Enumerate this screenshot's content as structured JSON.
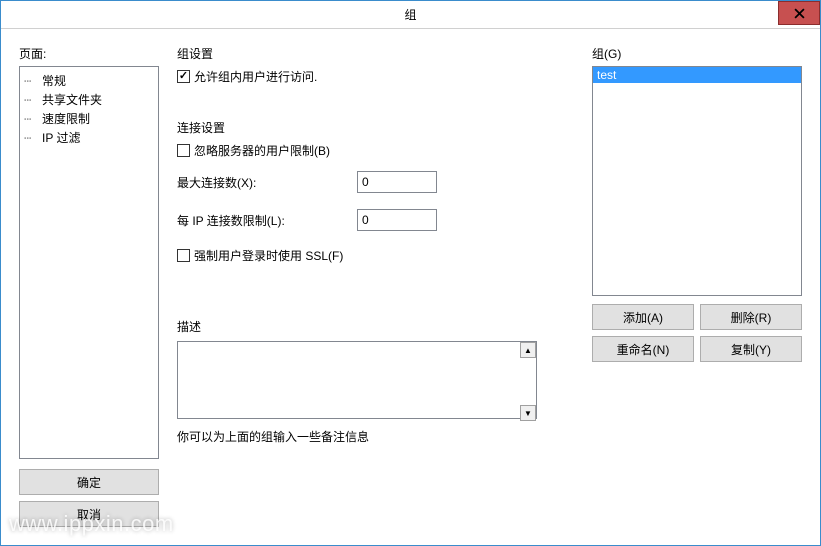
{
  "window": {
    "title": "组"
  },
  "left": {
    "label": "页面:",
    "tree": [
      {
        "label": "常规"
      },
      {
        "label": "共享文件夹"
      },
      {
        "label": "速度限制"
      },
      {
        "label": "IP 过滤"
      }
    ],
    "ok": "确定",
    "cancel": "取消"
  },
  "group_settings": {
    "title": "组设置",
    "allow_access": {
      "label": "允许组内用户进行访问.",
      "checked": true
    }
  },
  "conn_settings": {
    "title": "连接设置",
    "bypass_limit": {
      "label": "忽略服务器的用户限制(B)",
      "checked": false
    },
    "max_conn_label": "最大连接数(X):",
    "max_conn_value": "0",
    "per_ip_label": "每 IP 连接数限制(L):",
    "per_ip_value": "0",
    "force_ssl": {
      "label": "强制用户登录时使用 SSL(F)",
      "checked": false
    }
  },
  "description": {
    "title": "描述",
    "value": "",
    "hint": "你可以为上面的组输入一些备注信息"
  },
  "groups_panel": {
    "title": "组(G)",
    "items": [
      {
        "name": "test",
        "selected": true
      }
    ],
    "add": "添加(A)",
    "remove": "删除(R)",
    "rename": "重命名(N)",
    "copy": "复制(Y)"
  },
  "watermark": "www.ippxin.com"
}
